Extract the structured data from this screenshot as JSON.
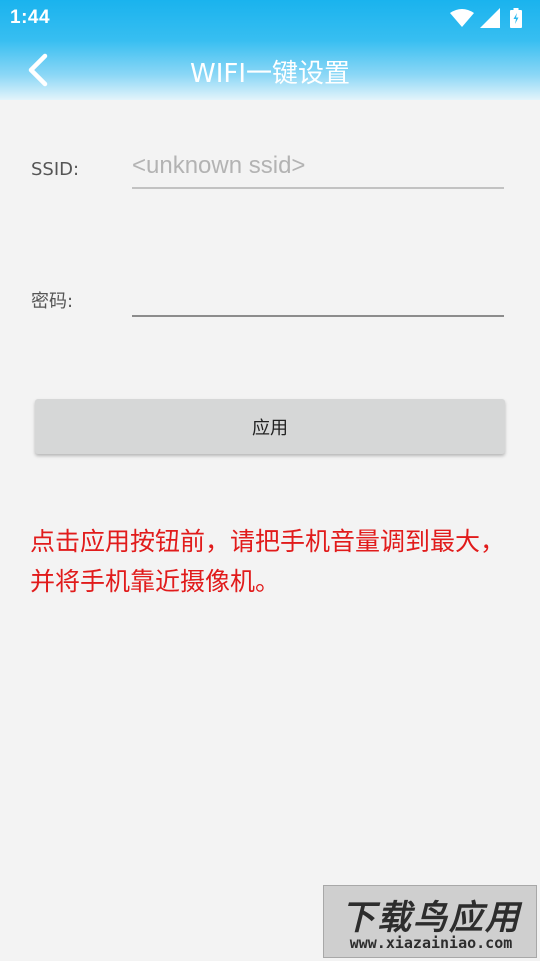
{
  "status_bar": {
    "time": "1:44",
    "icons": [
      "wifi-icon",
      "signal-icon",
      "battery-icon"
    ]
  },
  "header": {
    "back_icon": "chevron-left-icon",
    "title": "WIFI一键设置"
  },
  "form": {
    "ssid_label": "SSID:",
    "ssid_placeholder": "<unknown ssid>",
    "ssid_value": "",
    "password_label": "密码:",
    "password_value": "",
    "apply_label": "应用"
  },
  "hint_text": "点击应用按钮前，请把手机音量调到最大，并将手机靠近摄像机。",
  "watermark": {
    "logo_text": "下载鸟应用",
    "url": "www.xiazainiao.com"
  },
  "colors": {
    "header_blue": "#1ab3ee",
    "hint_red": "#e11b1b",
    "button_gray": "#d6d7d7",
    "background": "#f3f3f3"
  }
}
